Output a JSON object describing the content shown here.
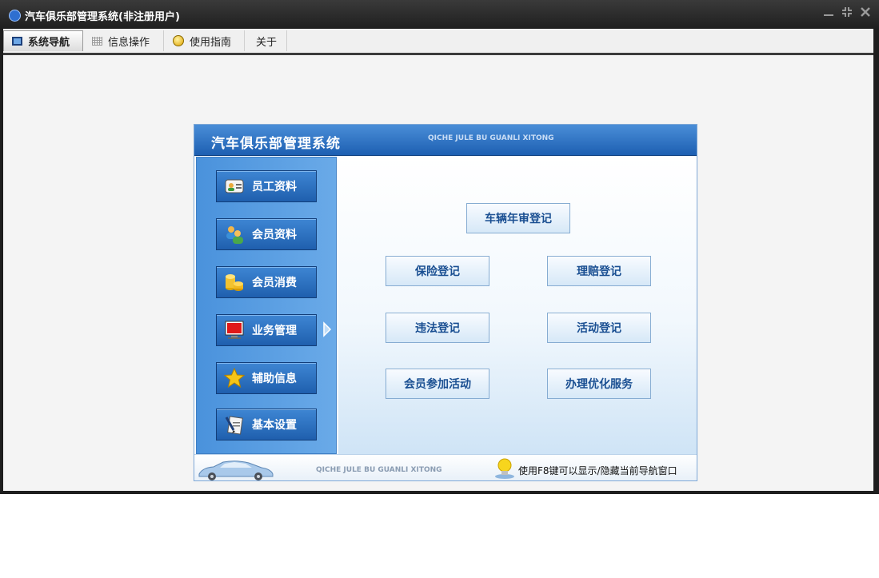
{
  "window": {
    "title": "汽车俱乐部管理系统(非注册用户)",
    "controls": [
      "minimize-icon",
      "restore-icon",
      "close-icon"
    ]
  },
  "menubar": {
    "tabs": [
      {
        "label": "系统导航",
        "icon": "monitor-icon",
        "active": true
      },
      {
        "label": "信息操作",
        "icon": "grid-icon",
        "active": false
      },
      {
        "label": "使用指南",
        "icon": "help-icon",
        "active": false
      },
      {
        "label": "关于",
        "icon": "",
        "active": false
      }
    ]
  },
  "panel": {
    "title": "汽车俱乐部管理系统",
    "subtitle": "QICHE JULE BU GUANLI XITONG",
    "nav": [
      {
        "label": "员工资料",
        "icon": "id-card-icon"
      },
      {
        "label": "会员资料",
        "icon": "users-icon"
      },
      {
        "label": "会员消费",
        "icon": "coins-icon"
      },
      {
        "label": "业务管理",
        "icon": "monitor-icon"
      },
      {
        "label": "辅助信息",
        "icon": "star-icon"
      },
      {
        "label": "基本设置",
        "icon": "settings-icon"
      }
    ],
    "actions": {
      "annual_inspection": "车辆年审登记",
      "insurance": "保险登记",
      "claims": "理赔登记",
      "violation": "违法登记",
      "activity": "活动登记",
      "member_join_activity": "会员参加活动",
      "optimize_service": "办理优化服务"
    },
    "footer": {
      "subtitle": "QICHE JULE BU GUANLI XITONG",
      "tip": "使用F8键可以显示/隐藏当前导航窗口"
    }
  },
  "colors": {
    "accent": "#1d5fb2",
    "title_bar": "#1f1f1f",
    "action_text": "#1a4f92"
  }
}
